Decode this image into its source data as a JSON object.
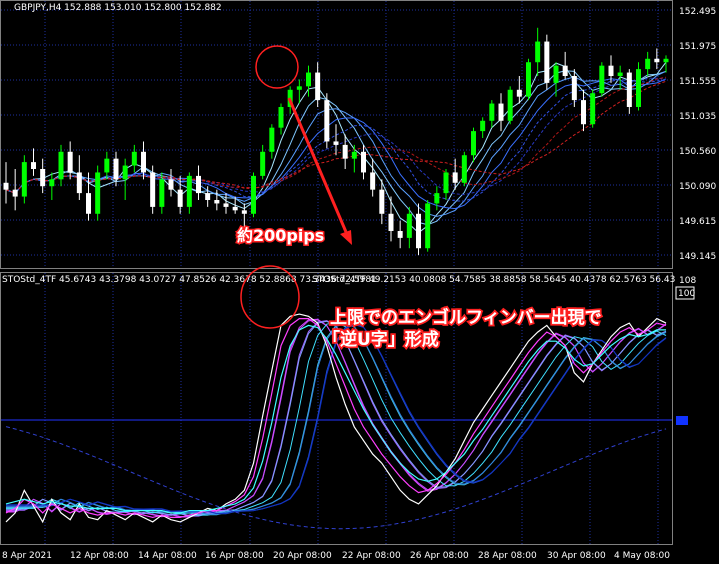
{
  "symbol_header": "GBPJPY,H4  152.888 153.010 152.800 152.882",
  "indicator_header_1": "STOStd_4TF 45.6743 43.3798 43.0727 47.8526 42.3678 52.8868 73.3436 72.5981",
  "indicator_header_2": "STOStd_4TF 49.2153 40.0808 54.7585 38.8858 58.5645 40.4378 62.5763 56.43",
  "price_axis": [
    "152.495",
    "151.975",
    "151.555",
    "151.035",
    "150.560",
    "150.090",
    "149.615",
    "149.145"
  ],
  "osc_axis_top": "108",
  "osc_axis_100": "100",
  "time_axis": [
    "8 Apr 2021",
    "12 Apr 08:00",
    "14 Apr 08:00",
    "16 Apr 08:00",
    "20 Apr 08:00",
    "22 Apr 08:00",
    "26 Apr 08:00",
    "28 Apr 08:00",
    "30 Apr 08:00",
    "4 May 08:00"
  ],
  "annotation_pips": "約200pips",
  "annotation_line1": "上限でのエンゴルフィンバー出現で",
  "annotation_line2": "「逆U字」形成",
  "colors": {
    "bg": "#000000",
    "grid": "#1e2fa0",
    "bull": "#00ff00",
    "bear": "#ffffff",
    "arrow": "#ff2020",
    "circle": "#ff2020",
    "level": "#2233ff"
  },
  "chart_data": [
    {
      "type": "candlestick",
      "title": "GBPJPY,H4",
      "ylim": [
        149.0,
        152.6
      ],
      "ohlc": [
        [
          150.15,
          150.45,
          149.85,
          150.05
        ],
        [
          150.05,
          150.35,
          149.75,
          149.95
        ],
        [
          149.95,
          150.55,
          149.85,
          150.45
        ],
        [
          150.45,
          150.65,
          150.25,
          150.35
        ],
        [
          150.35,
          150.5,
          150.0,
          150.1
        ],
        [
          150.1,
          150.3,
          149.9,
          150.2
        ],
        [
          150.2,
          150.7,
          150.1,
          150.6
        ],
        [
          150.6,
          150.75,
          150.2,
          150.3
        ],
        [
          150.3,
          150.55,
          149.9,
          150.0
        ],
        [
          150.0,
          150.3,
          149.6,
          149.7
        ],
        [
          149.7,
          150.4,
          149.6,
          150.3
        ],
        [
          150.3,
          150.6,
          150.2,
          150.5
        ],
        [
          150.5,
          150.6,
          150.1,
          150.2
        ],
        [
          150.2,
          150.5,
          149.9,
          150.4
        ],
        [
          150.4,
          150.7,
          150.3,
          150.6
        ],
        [
          150.6,
          150.75,
          150.2,
          150.3
        ],
        [
          150.3,
          150.4,
          149.7,
          149.8
        ],
        [
          149.8,
          150.3,
          149.7,
          150.2
        ],
        [
          150.2,
          150.35,
          149.95,
          150.05
        ],
        [
          150.05,
          150.25,
          149.7,
          149.8
        ],
        [
          149.8,
          150.3,
          149.7,
          150.25
        ],
        [
          150.25,
          150.4,
          149.9,
          150.0
        ],
        [
          150.0,
          150.1,
          149.8,
          149.9
        ],
        [
          149.9,
          150.05,
          149.75,
          149.85
        ],
        [
          149.85,
          150.0,
          149.7,
          149.8
        ],
        [
          149.8,
          149.95,
          149.7,
          149.75
        ],
        [
          149.75,
          149.85,
          149.45,
          149.7
        ],
        [
          149.7,
          150.3,
          149.65,
          150.25
        ],
        [
          150.25,
          150.7,
          150.2,
          150.6
        ],
        [
          150.6,
          151.0,
          150.5,
          150.95
        ],
        [
          150.95,
          151.3,
          150.85,
          151.25
        ],
        [
          151.25,
          151.55,
          151.15,
          151.5
        ],
        [
          151.5,
          151.65,
          151.3,
          151.55
        ],
        [
          151.55,
          151.85,
          151.4,
          151.75
        ],
        [
          151.75,
          151.9,
          151.25,
          151.35
        ],
        [
          151.35,
          151.45,
          150.65,
          150.75
        ],
        [
          150.75,
          151.0,
          150.55,
          150.7
        ],
        [
          150.7,
          150.85,
          150.35,
          150.5
        ],
        [
          150.5,
          150.7,
          150.3,
          150.6
        ],
        [
          150.6,
          150.7,
          150.2,
          150.3
        ],
        [
          150.3,
          150.5,
          149.95,
          150.05
        ],
        [
          150.05,
          150.2,
          149.55,
          149.7
        ],
        [
          149.7,
          149.95,
          149.3,
          149.45
        ],
        [
          149.45,
          149.6,
          149.2,
          149.35
        ],
        [
          149.35,
          149.8,
          149.2,
          149.7
        ],
        [
          149.7,
          149.85,
          149.1,
          149.2
        ],
        [
          149.2,
          149.9,
          149.15,
          149.85
        ],
        [
          149.85,
          150.1,
          149.75,
          150.0
        ],
        [
          150.0,
          150.35,
          149.9,
          150.3
        ],
        [
          150.3,
          150.5,
          150.05,
          150.15
        ],
        [
          150.15,
          150.6,
          150.1,
          150.55
        ],
        [
          150.55,
          150.95,
          150.45,
          150.9
        ],
        [
          150.9,
          151.1,
          150.8,
          151.05
        ],
        [
          151.05,
          151.35,
          150.95,
          151.3
        ],
        [
          151.3,
          151.45,
          150.9,
          151.05
        ],
        [
          151.05,
          151.55,
          151.0,
          151.5
        ],
        [
          151.5,
          151.7,
          151.3,
          151.4
        ],
        [
          151.4,
          151.95,
          151.35,
          151.9
        ],
        [
          151.9,
          152.4,
          151.7,
          152.2
        ],
        [
          152.2,
          152.3,
          151.5,
          151.6
        ],
        [
          151.6,
          151.9,
          151.4,
          151.85
        ],
        [
          151.85,
          152.05,
          151.65,
          151.7
        ],
        [
          151.7,
          151.8,
          151.25,
          151.35
        ],
        [
          151.35,
          151.5,
          150.9,
          151.0
        ],
        [
          151.0,
          151.5,
          150.95,
          151.45
        ],
        [
          151.45,
          151.9,
          151.4,
          151.85
        ],
        [
          151.85,
          152.0,
          151.6,
          151.7
        ],
        [
          151.7,
          151.85,
          151.5,
          151.75
        ],
        [
          151.75,
          151.8,
          151.15,
          151.25
        ],
        [
          151.25,
          151.9,
          151.2,
          151.8
        ],
        [
          151.8,
          152.05,
          151.7,
          151.95
        ],
        [
          151.95,
          152.1,
          151.8,
          151.9
        ],
        [
          151.9,
          152.0,
          151.75,
          151.95
        ]
      ]
    },
    {
      "type": "line",
      "title": "STOStd_4TF",
      "ylim": [
        0,
        108
      ],
      "series": [
        {
          "values": [
            8,
            12,
            22,
            15,
            8,
            18,
            12,
            9,
            16,
            10,
            9,
            13,
            11,
            9,
            12,
            10,
            8,
            11,
            9,
            8,
            10,
            12,
            14,
            13,
            16,
            18,
            22,
            34,
            55,
            75,
            95,
            99,
            100,
            99,
            96,
            86,
            72,
            60,
            50,
            44,
            38,
            34,
            28,
            22,
            18,
            16,
            20,
            24,
            30,
            36,
            44,
            52,
            58,
            64,
            70,
            76,
            82,
            88,
            92,
            95,
            90,
            86,
            74,
            70,
            78,
            84,
            90,
            94,
            96,
            90,
            94,
            98,
            96
          ]
        },
        {
          "values": [
            12,
            14,
            18,
            16,
            12,
            16,
            14,
            12,
            14,
            12,
            11,
            12,
            12,
            11,
            12,
            11,
            10,
            11,
            10,
            10,
            11,
            12,
            13,
            13,
            15,
            17,
            20,
            28,
            45,
            65,
            86,
            95,
            98,
            98,
            95,
            88,
            78,
            68,
            58,
            50,
            44,
            38,
            33,
            28,
            24,
            21,
            22,
            25,
            29,
            34,
            40,
            47,
            53,
            59,
            65,
            71,
            77,
            83,
            88,
            92,
            90,
            86,
            78,
            74,
            78,
            83,
            88,
            92,
            94,
            91,
            93,
            96,
            95
          ]
        },
        {
          "values": [
            16,
            17,
            18,
            17,
            16,
            17,
            16,
            15,
            15,
            14,
            14,
            14,
            14,
            13,
            13,
            13,
            13,
            13,
            12,
            12,
            13,
            13,
            13,
            14,
            15,
            16,
            18,
            23,
            35,
            52,
            72,
            86,
            93,
            95,
            94,
            89,
            82,
            74,
            66,
            58,
            51,
            45,
            39,
            34,
            30,
            27,
            26,
            27,
            30,
            34,
            38,
            44,
            49,
            55,
            61,
            67,
            73,
            79,
            84,
            88,
            88,
            85,
            80,
            77,
            78,
            82,
            86,
            89,
            91,
            90,
            91,
            93,
            93
          ]
        }
      ]
    }
  ]
}
